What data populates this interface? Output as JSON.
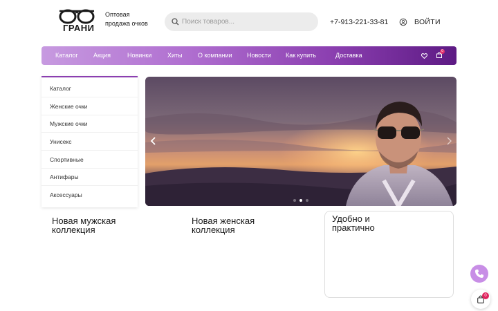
{
  "header": {
    "logo_text": "ГРАНИ",
    "tagline_line1": "Оптовая",
    "tagline_line2": "продажа очков",
    "search_placeholder": "Поиск товаров...",
    "phone": "+7-913-221-33-81",
    "login_label": "ВОЙТИ"
  },
  "nav": {
    "items": [
      "Каталог",
      "Акция",
      "Новинки",
      "Хиты",
      "О компании",
      "Новости",
      "Как купить",
      "Доставка"
    ],
    "cart_count": "0"
  },
  "sidebar": {
    "items": [
      "Каталог",
      "Женские очки",
      "Мужские очки",
      "Унисекс",
      "Спортивные",
      "Антифары",
      "Аксессуары"
    ]
  },
  "banner": {
    "slides_count": 3,
    "active_slide": 2
  },
  "collections": {
    "men_line1": "Новая мужская",
    "men_line2": "коллекция",
    "women_line1": "Новая женская",
    "women_line2": "коллекция",
    "convenient_line1": "Удобно и",
    "convenient_line2": "практично"
  },
  "floating": {
    "cart_count": "0"
  },
  "colors": {
    "nav_gradient_start": "#c79ae0",
    "nav_gradient_end": "#5d1a84",
    "accent": "#8b3fb0",
    "badge": "#e0245e"
  }
}
